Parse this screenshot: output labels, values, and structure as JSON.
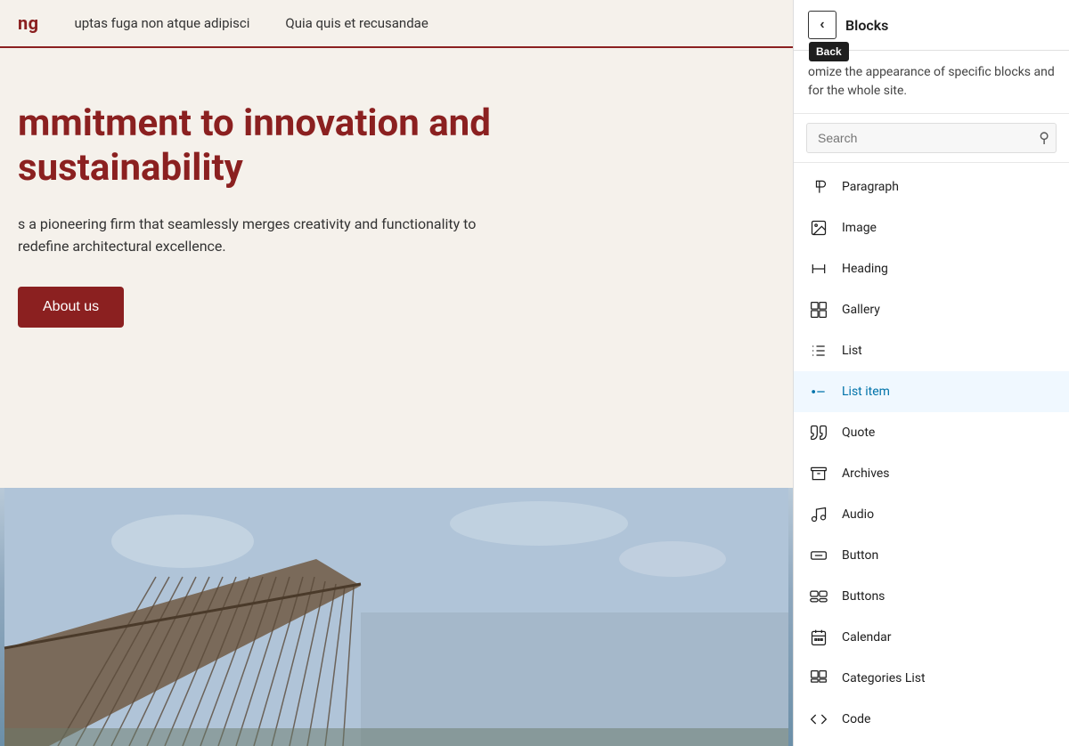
{
  "main": {
    "nav": {
      "title": "ng",
      "links": [
        {
          "label": "uptas fuga non atque adipisci"
        },
        {
          "label": "Quia quis et recusandae"
        }
      ]
    },
    "hero": {
      "title": "mmitment to innovation and sustainability",
      "subtitle": "s a pioneering firm that seamlessly merges creativity and functionality to redefine architectural excellence.",
      "cta_label": "About us"
    }
  },
  "sidebar": {
    "back_label": "‹",
    "back_tooltip": "Back",
    "title": "Blocks",
    "description": "omize the appearance of specific blocks and for the whole site.",
    "search": {
      "placeholder": "Search",
      "value": ""
    },
    "blocks": [
      {
        "id": "paragraph",
        "label": "Paragraph",
        "icon": "paragraph"
      },
      {
        "id": "image",
        "label": "Image",
        "icon": "image"
      },
      {
        "id": "heading",
        "label": "Heading",
        "icon": "heading"
      },
      {
        "id": "gallery",
        "label": "Gallery",
        "icon": "gallery"
      },
      {
        "id": "list",
        "label": "List",
        "icon": "list"
      },
      {
        "id": "list-item",
        "label": "List item",
        "icon": "list-item",
        "active": true
      },
      {
        "id": "quote",
        "label": "Quote",
        "icon": "quote"
      },
      {
        "id": "archives",
        "label": "Archives",
        "icon": "archives"
      },
      {
        "id": "audio",
        "label": "Audio",
        "icon": "audio"
      },
      {
        "id": "button",
        "label": "Button",
        "icon": "button"
      },
      {
        "id": "buttons",
        "label": "Buttons",
        "icon": "buttons"
      },
      {
        "id": "calendar",
        "label": "Calendar",
        "icon": "calendar"
      },
      {
        "id": "categories-list",
        "label": "Categories List",
        "icon": "categories-list"
      },
      {
        "id": "code",
        "label": "Code",
        "icon": "code"
      }
    ]
  }
}
